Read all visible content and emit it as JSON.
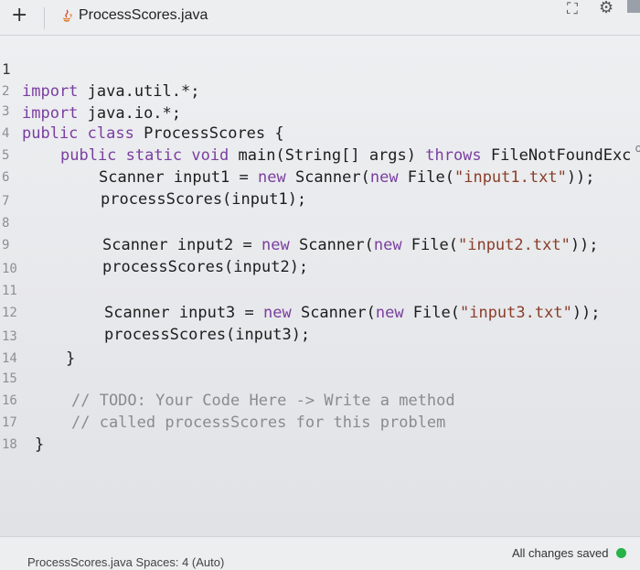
{
  "toolbar": {
    "new_tab_label": "+",
    "tab_title": "ProcessScores.java",
    "maximize_icon": "maximize-icon",
    "settings_icon": "gear-icon"
  },
  "code_lines": [
    {
      "n": "1",
      "text": "import java.util.*;"
    },
    {
      "n": "2",
      "text": "import java.io.*;"
    },
    {
      "n": "3",
      "text": "public class ProcessScores {"
    },
    {
      "n": "4",
      "text": "public static void main(String[] args) throws FileNotFoundExc"
    },
    {
      "n": "5",
      "text": "Scanner input1 = new Scanner(new File(\"input1.txt\"));"
    },
    {
      "n": "6",
      "text": "processScores(input1);"
    },
    {
      "n": "7",
      "text": ""
    },
    {
      "n": "8",
      "text": "Scanner input2 = new Scanner(new File(\"input2.txt\"));"
    },
    {
      "n": "9",
      "text": "processScores(input2);"
    },
    {
      "n": "10",
      "text": ""
    },
    {
      "n": "11",
      "text": "Scanner input3 = new Scanner(new File(\"input3.txt\"));"
    },
    {
      "n": "12",
      "text": "processScores(input3);"
    },
    {
      "n": "13",
      "text": "}"
    },
    {
      "n": "14",
      "text": ""
    },
    {
      "n": "15",
      "text": "// TODO: Your Code Here -> Write a method"
    },
    {
      "n": "16",
      "text": "// called processScores for this problem"
    },
    {
      "n": "17",
      "text": "}"
    },
    {
      "n": "18",
      "text": ""
    }
  ],
  "status": {
    "file_and_spaces": "ProcessScores.java   Spaces: 4 (Auto)",
    "save_state": "All changes saved"
  },
  "colors": {
    "keyword": "#7a3ea0",
    "string": "#8a3d2a",
    "comment": "#8a8b8d",
    "saved_indicator": "#27b34a"
  }
}
